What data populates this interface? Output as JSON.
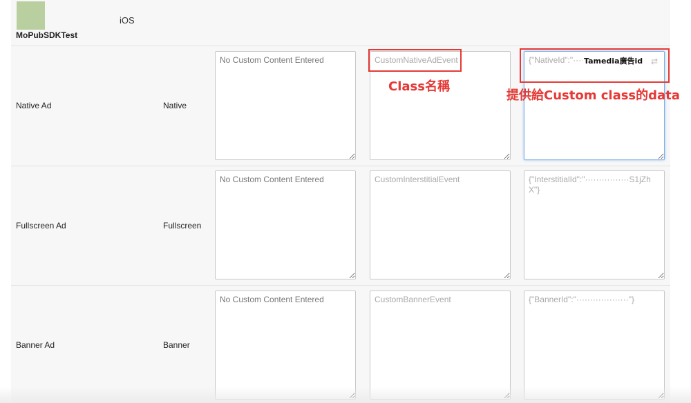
{
  "header": {
    "app_name": "MoPubSDKTest",
    "platform": "iOS"
  },
  "rows": [
    {
      "label": "Native Ad",
      "format": "Native",
      "custom_content_placeholder": "No Custom Content Entered",
      "class_name": "CustomNativeAdEvent",
      "data_json": "{\"NativeId\":\"·····················\"}"
    },
    {
      "label": "Fullscreen Ad",
      "format": "Fullscreen",
      "custom_content_placeholder": "No Custom Content Entered",
      "class_name": "CustomInterstitialEvent",
      "data_json": "{\"InterstitialId\":\"················S1jZhX\"}"
    },
    {
      "label": "Banner Ad",
      "format": "Banner",
      "custom_content_placeholder": "No Custom Content Entered",
      "class_name": "CustomBannerEvent",
      "data_json": "{\"BannerId\":\"···················\"}"
    }
  ],
  "annotations": {
    "class_label": "Class名稱",
    "data_label": "提供給Custom class的data",
    "overlay_label": "Tamedia廣告id"
  },
  "colors": {
    "annotation": "#e53935",
    "focus": "#7fb1e8",
    "app_icon": "#b9cf9f"
  }
}
